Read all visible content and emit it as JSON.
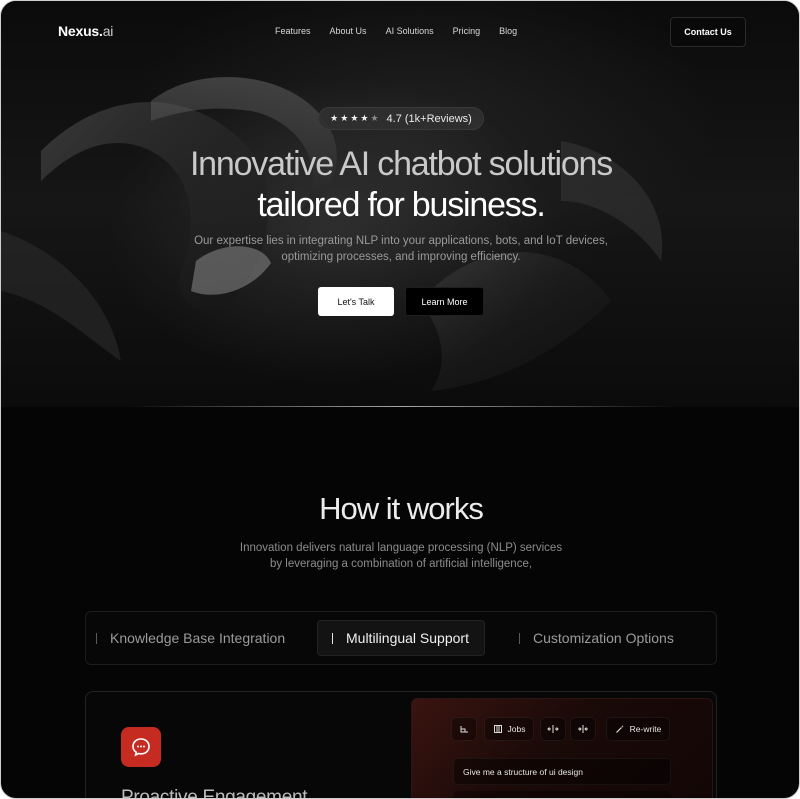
{
  "header": {
    "logo_main": "Nexus.",
    "logo_suffix": "ai",
    "nav": [
      "Features",
      "About Us",
      "AI Solutions",
      "Pricing",
      "Blog"
    ],
    "contact_label": "Contact Us"
  },
  "hero": {
    "rating_stars": 4.5,
    "rating_text": "4.7 (1k+Reviews)",
    "headline_line1": "Innovative AI chatbot solutions",
    "headline_line2": "tailored for business.",
    "subtext_line1": "Our expertise lies in integrating NLP into your applications, bots, and IoT devices,",
    "subtext_line2": "optimizing processes, and improving efficiency.",
    "primary_button": "Let's Talk",
    "secondary_button": "Learn More"
  },
  "how": {
    "title": "How it works",
    "sub_line1": "Innovation delivers natural language processing (NLP) services",
    "sub_line2": "by leveraging a combination of artificial intelligence,",
    "tabs": [
      {
        "label": "Knowledge Base Integration",
        "active": false
      },
      {
        "label": "Multilingual Support",
        "active": true
      },
      {
        "label": "Customization Options",
        "active": false
      }
    ]
  },
  "card": {
    "title": "Proactive Engagement",
    "icon": "chat-bubble-icon",
    "accent": "#c62b22",
    "toolbar": {
      "jobs_label": "Jobs",
      "rewrite_label": "Re-write"
    },
    "prompt_text": "Give me a structure of ui design"
  }
}
